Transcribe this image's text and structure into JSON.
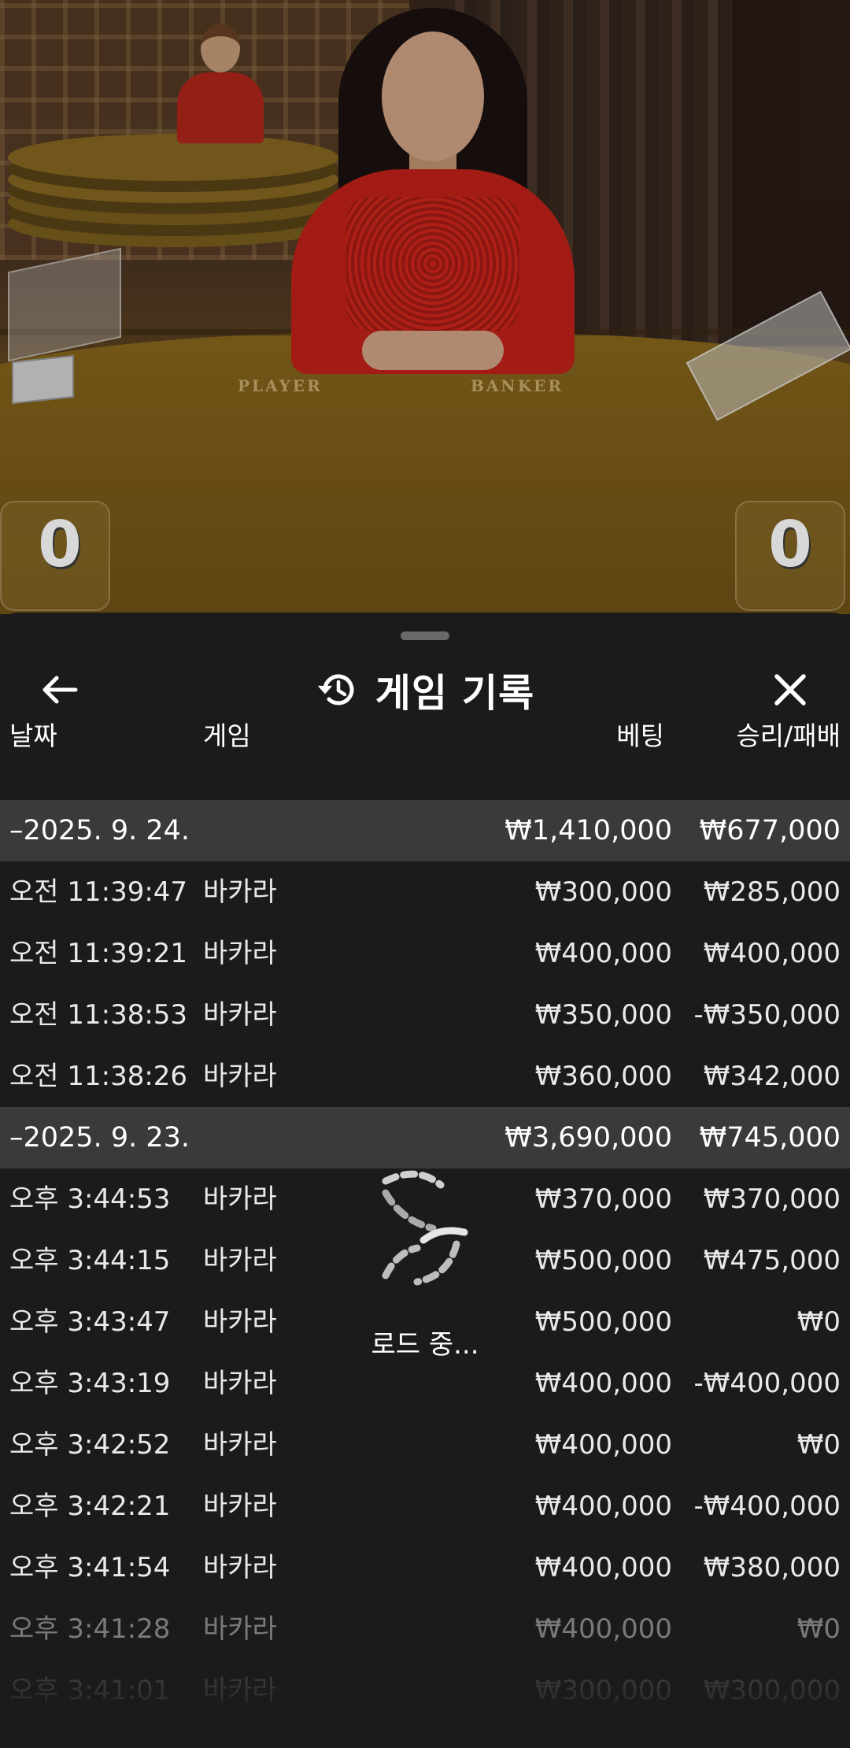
{
  "video": {
    "table_labels": {
      "player": "PLAYER",
      "banker": "BANKER"
    },
    "player_score": "0",
    "banker_score": "0"
  },
  "sheet": {
    "title": "게임 기록",
    "title_icon": "history-icon",
    "back_icon": "arrow-left-icon",
    "close_icon": "close-icon",
    "columns": {
      "date": "날짜",
      "game": "게임",
      "bet": "베팅",
      "result": "승리/패배"
    },
    "rows": [
      {
        "type": "group",
        "date": "–2025. 9. 24.",
        "game": "",
        "bet": "₩1,410,000",
        "result": "₩677,000"
      },
      {
        "type": "item",
        "date": "오전 11:39:47",
        "game": "바카라",
        "bet": "₩300,000",
        "result": "₩285,000"
      },
      {
        "type": "item",
        "date": "오전 11:39:21",
        "game": "바카라",
        "bet": "₩400,000",
        "result": "₩400,000"
      },
      {
        "type": "item",
        "date": "오전 11:38:53",
        "game": "바카라",
        "bet": "₩350,000",
        "result": "-₩350,000"
      },
      {
        "type": "item",
        "date": "오전 11:38:26",
        "game": "바카라",
        "bet": "₩360,000",
        "result": "₩342,000"
      },
      {
        "type": "group",
        "date": "–2025. 9. 23.",
        "game": "",
        "bet": "₩3,690,000",
        "result": "₩745,000"
      },
      {
        "type": "item",
        "date": "오후 3:44:53",
        "game": "바카라",
        "bet": "₩370,000",
        "result": "₩370,000"
      },
      {
        "type": "item",
        "date": "오후 3:44:15",
        "game": "바카라",
        "bet": "₩500,000",
        "result": "₩475,000"
      },
      {
        "type": "item",
        "date": "오후 3:43:47",
        "game": "바카라",
        "bet": "₩500,000",
        "result": "₩0"
      },
      {
        "type": "item",
        "date": "오후 3:43:19",
        "game": "바카라",
        "bet": "₩400,000",
        "result": "-₩400,000"
      },
      {
        "type": "item",
        "date": "오후 3:42:52",
        "game": "바카라",
        "bet": "₩400,000",
        "result": "₩0"
      },
      {
        "type": "item",
        "date": "오후 3:42:21",
        "game": "바카라",
        "bet": "₩400,000",
        "result": "-₩400,000"
      },
      {
        "type": "item",
        "date": "오후 3:41:54",
        "game": "바카라",
        "bet": "₩400,000",
        "result": "₩380,000"
      },
      {
        "type": "item",
        "fade": 1,
        "date": "오후 3:41:28",
        "game": "바카라",
        "bet": "₩400,000",
        "result": "₩0"
      },
      {
        "type": "item",
        "fade": 2,
        "date": "오후 3:41:01",
        "game": "바카라",
        "bet": "₩300,000",
        "result": "₩300,000"
      }
    ],
    "loading_text": "로드 중...",
    "loading_icon": "loading-spinner-icon"
  }
}
